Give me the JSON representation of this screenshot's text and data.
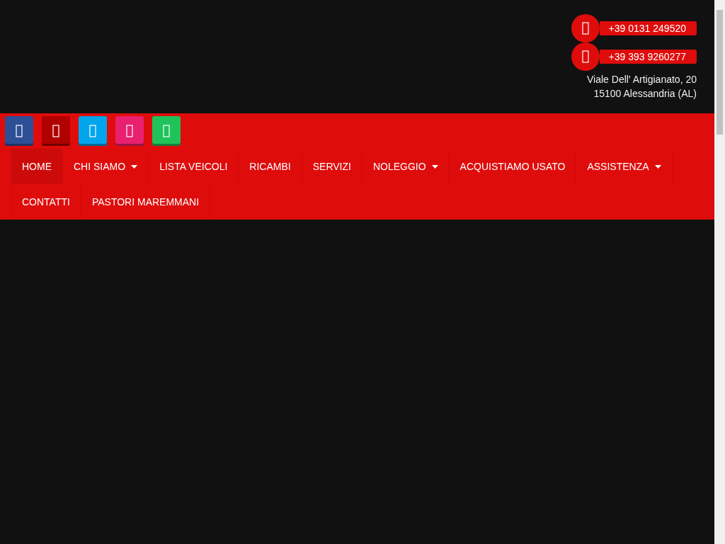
{
  "contacts": {
    "phones": [
      {
        "number": "+39 0131 249520"
      },
      {
        "number": "+39 393 9260277"
      }
    ],
    "address": [
      "Viale Dell' Artigianato, 20",
      "15100 Alessandria (AL)"
    ]
  },
  "social_buttons": [
    {
      "color": "#2d4f96"
    },
    {
      "color": "#b10000"
    },
    {
      "color": "#00a5ec"
    },
    {
      "color": "#e8206f"
    },
    {
      "color": "#1fc35a"
    }
  ],
  "nav": [
    {
      "label": "HOME",
      "selected": true,
      "dropdown": false
    },
    {
      "label": "CHI SIAMO",
      "selected": false,
      "dropdown": true
    },
    {
      "label": "LISTA VEICOLI",
      "selected": false,
      "dropdown": false
    },
    {
      "label": "RICAMBI",
      "selected": false,
      "dropdown": false
    },
    {
      "label": "SERVIZI",
      "selected": false,
      "dropdown": false
    },
    {
      "label": "NOLEGGIO",
      "selected": false,
      "dropdown": true
    },
    {
      "label": "ACQUISTIAMO USATO",
      "selected": false,
      "dropdown": false
    },
    {
      "label": "ASSISTENZA",
      "selected": false,
      "dropdown": true
    },
    {
      "label": "CONTATTI",
      "selected": false,
      "dropdown": false
    },
    {
      "label": "PASTORI MAREMMANI",
      "selected": false,
      "dropdown": false
    }
  ]
}
